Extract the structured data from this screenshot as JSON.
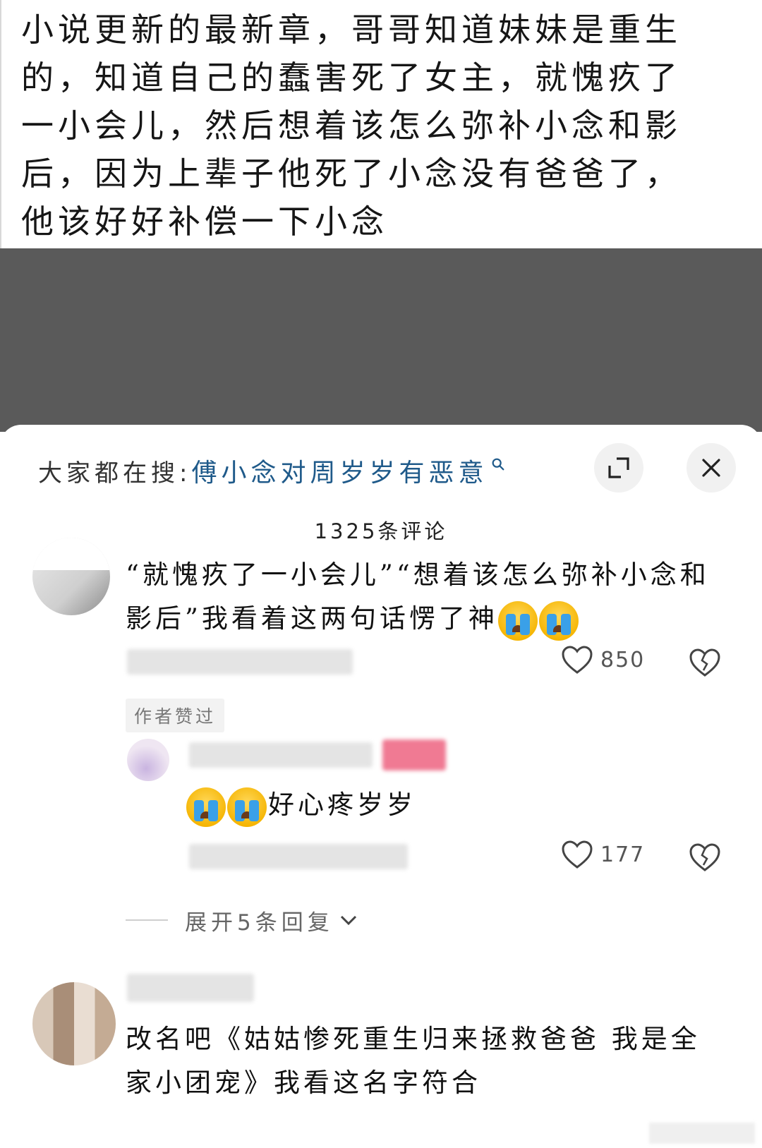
{
  "post": {
    "text": "小说更新的最新章，哥哥知道妹妹是重生的，知道自己的蠢害死了女主，就愧疚了一小会儿，然后想着该怎么弥补小念和影后，因为上辈子他死了小念没有爸爸了，他该好好补偿一下小念"
  },
  "search": {
    "prefix": "大家都在搜:",
    "term": "傅小念对周岁岁有恶意"
  },
  "comments_header": {
    "count_label": "1325条评论"
  },
  "comments": [
    {
      "text": "“就愧疚了一小会儿”“想着该怎么弥补小念和影后”我看着这两句话愣了神",
      "likes": "850",
      "badge": "作者赞过"
    },
    {
      "text": "好心疼岁岁",
      "likes": "177"
    }
  ],
  "expand_replies": {
    "label": "展开5条回复"
  },
  "comment3": {
    "text": "改名吧《姑姑惨死重生归来拯救爸爸 我是全家小团宠》我看这名字符合"
  },
  "icons": {
    "search": "search-icon",
    "expand": "expand-icon",
    "close": "close-icon",
    "like": "heart-icon",
    "dislike": "broken-heart-icon",
    "emoji": "crying-emoji-icon",
    "chevron": "chevron-down-icon"
  },
  "colors": {
    "search_term": "#1f5a8a",
    "band": "#5a5a5a"
  }
}
